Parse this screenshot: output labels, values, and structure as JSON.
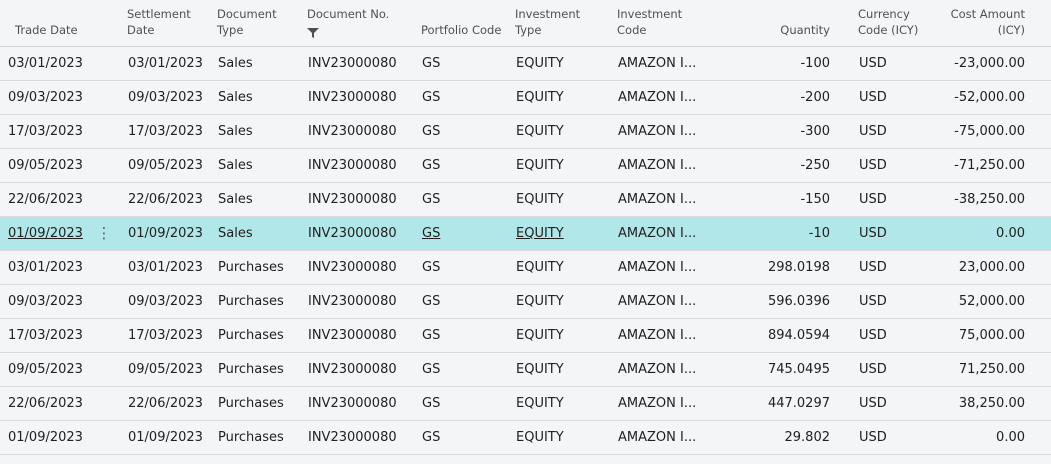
{
  "headers": {
    "trade_date": "Trade Date",
    "settlement_date_l1": "Settlement",
    "settlement_date_l2": "Date",
    "document_type_l1": "Document",
    "document_type_l2": "Type",
    "document_no": "Document No.",
    "portfolio_code": "Portfolio Code",
    "investment_type_l1": "Investment",
    "investment_type_l2": "Type",
    "investment_code_l1": "Investment",
    "investment_code_l2": "Code",
    "quantity": "Quantity",
    "currency_code_l1": "Currency",
    "currency_code_l2": "Code (ICY)",
    "cost_amount_l1": "Cost Amount",
    "cost_amount_l2": "(ICY)"
  },
  "rows": [
    {
      "trade_date": "03/01/2023",
      "settlement_date": "03/01/2023",
      "document_type": "Sales",
      "document_no": "INV23000080",
      "portfolio_code": "GS",
      "investment_type": "EQUITY",
      "investment_code": "AMAZON I...",
      "quantity": "-100",
      "currency_code": "USD",
      "cost_amount": "-23,000.00"
    },
    {
      "trade_date": "09/03/2023",
      "settlement_date": "09/03/2023",
      "document_type": "Sales",
      "document_no": "INV23000080",
      "portfolio_code": "GS",
      "investment_type": "EQUITY",
      "investment_code": "AMAZON I...",
      "quantity": "-200",
      "currency_code": "USD",
      "cost_amount": "-52,000.00"
    },
    {
      "trade_date": "17/03/2023",
      "settlement_date": "17/03/2023",
      "document_type": "Sales",
      "document_no": "INV23000080",
      "portfolio_code": "GS",
      "investment_type": "EQUITY",
      "investment_code": "AMAZON I...",
      "quantity": "-300",
      "currency_code": "USD",
      "cost_amount": "-75,000.00"
    },
    {
      "trade_date": "09/05/2023",
      "settlement_date": "09/05/2023",
      "document_type": "Sales",
      "document_no": "INV23000080",
      "portfolio_code": "GS",
      "investment_type": "EQUITY",
      "investment_code": "AMAZON I...",
      "quantity": "-250",
      "currency_code": "USD",
      "cost_amount": "-71,250.00"
    },
    {
      "trade_date": "22/06/2023",
      "settlement_date": "22/06/2023",
      "document_type": "Sales",
      "document_no": "INV23000080",
      "portfolio_code": "GS",
      "investment_type": "EQUITY",
      "investment_code": "AMAZON I...",
      "quantity": "-150",
      "currency_code": "USD",
      "cost_amount": "-38,250.00"
    },
    {
      "trade_date": "01/09/2023",
      "settlement_date": "01/09/2023",
      "document_type": "Sales",
      "document_no": "INV23000080",
      "portfolio_code": "GS",
      "investment_type": "EQUITY",
      "investment_code": "AMAZON I...",
      "quantity": "-10",
      "currency_code": "USD",
      "cost_amount": "0.00",
      "selected": true
    },
    {
      "trade_date": "03/01/2023",
      "settlement_date": "03/01/2023",
      "document_type": "Purchases",
      "document_no": "INV23000080",
      "portfolio_code": "GS",
      "investment_type": "EQUITY",
      "investment_code": "AMAZON I...",
      "quantity": "298.0198",
      "currency_code": "USD",
      "cost_amount": "23,000.00"
    },
    {
      "trade_date": "09/03/2023",
      "settlement_date": "09/03/2023",
      "document_type": "Purchases",
      "document_no": "INV23000080",
      "portfolio_code": "GS",
      "investment_type": "EQUITY",
      "investment_code": "AMAZON I...",
      "quantity": "596.0396",
      "currency_code": "USD",
      "cost_amount": "52,000.00"
    },
    {
      "trade_date": "17/03/2023",
      "settlement_date": "17/03/2023",
      "document_type": "Purchases",
      "document_no": "INV23000080",
      "portfolio_code": "GS",
      "investment_type": "EQUITY",
      "investment_code": "AMAZON I...",
      "quantity": "894.0594",
      "currency_code": "USD",
      "cost_amount": "75,000.00"
    },
    {
      "trade_date": "09/05/2023",
      "settlement_date": "09/05/2023",
      "document_type": "Purchases",
      "document_no": "INV23000080",
      "portfolio_code": "GS",
      "investment_type": "EQUITY",
      "investment_code": "AMAZON I...",
      "quantity": "745.0495",
      "currency_code": "USD",
      "cost_amount": "71,250.00"
    },
    {
      "trade_date": "22/06/2023",
      "settlement_date": "22/06/2023",
      "document_type": "Purchases",
      "document_no": "INV23000080",
      "portfolio_code": "GS",
      "investment_type": "EQUITY",
      "investment_code": "AMAZON I...",
      "quantity": "447.0297",
      "currency_code": "USD",
      "cost_amount": "38,250.00"
    },
    {
      "trade_date": "01/09/2023",
      "settlement_date": "01/09/2023",
      "document_type": "Purchases",
      "document_no": "INV23000080",
      "portfolio_code": "GS",
      "investment_type": "EQUITY",
      "investment_code": "AMAZON I...",
      "quantity": "29.802",
      "currency_code": "USD",
      "cost_amount": "0.00"
    }
  ],
  "row_menu_glyph": "⋮",
  "icons": {
    "filter": "filter-icon",
    "row_menu": "more-vertical-icon"
  },
  "colors": {
    "selected_row": "#b2e7ea",
    "background": "#f4f5f7",
    "row_border": "#dcdcdc"
  }
}
